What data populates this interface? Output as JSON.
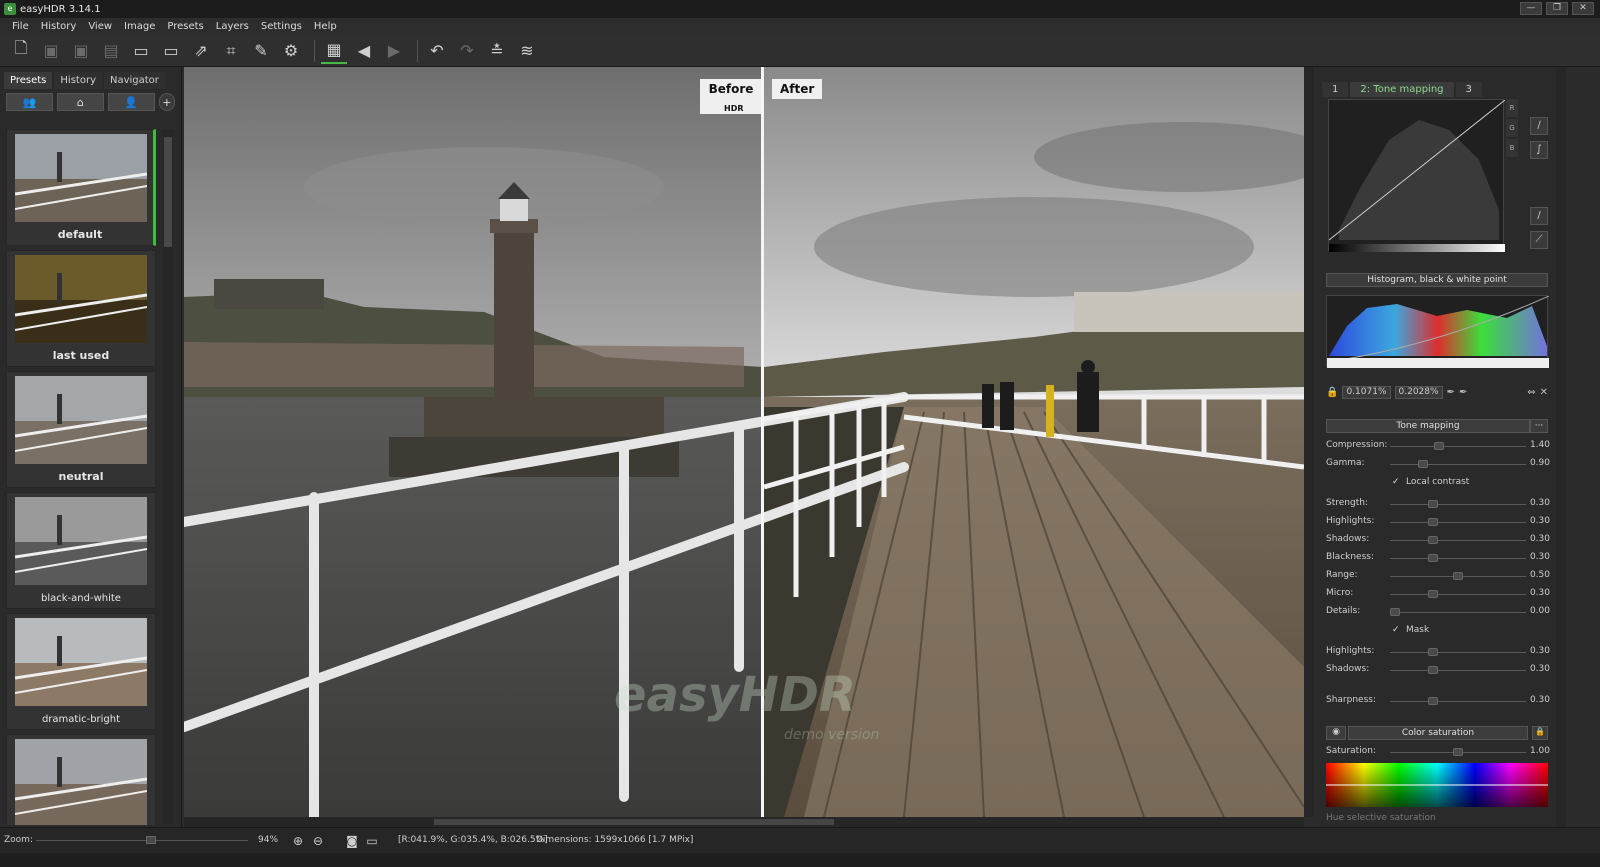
{
  "window": {
    "title": "easyHDR 3.14.1",
    "icon": "app-icon"
  },
  "window_controls": {
    "minimize": "—",
    "maximize": "❐",
    "close": "✕"
  },
  "menu": [
    "File",
    "History",
    "View",
    "Image",
    "Presets",
    "Layers",
    "Settings",
    "Help"
  ],
  "toolbar": {
    "icons": [
      "new-file-icon",
      "open-bracket-icon",
      "open-multi-icon",
      "batch-icon",
      "save-icon",
      "save-as-icon",
      "export-icon",
      "crop-icon",
      "healing-icon",
      "settings-icon",
      "preview-toggle-icon",
      "back-icon",
      "forward-icon",
      "undo-icon",
      "redo-icon",
      "auto-align-icon",
      "layers-icon"
    ]
  },
  "left_panel": {
    "tabs": [
      "Presets",
      "History",
      "Navigator"
    ],
    "active_tab": "Presets",
    "preset_filter_icons": [
      "group-users-icon",
      "home-icon",
      "user-icon",
      "add-icon"
    ],
    "presets": [
      {
        "label": "default",
        "selected": true
      },
      {
        "label": "last used"
      },
      {
        "label": "neutral"
      },
      {
        "label": "black-and-white"
      },
      {
        "label": "dramatic-bright"
      },
      {
        "label": ""
      }
    ]
  },
  "viewer": {
    "before_label": "Before",
    "before_sub": "HDR",
    "after_label": "After",
    "watermark": "easyHDR",
    "watermark_sub": "demo version"
  },
  "right_panel": {
    "tabs": [
      "1",
      "2: Tone mapping",
      "3"
    ],
    "active_tab": "2: Tone mapping",
    "rgb": [
      "R",
      "G",
      "B"
    ],
    "histogram_header": "Histogram, black & white point",
    "black_point": "0.1071%",
    "white_point": "0.2028%",
    "tone_header": "Tone mapping",
    "tone_menu": "···",
    "sliders_top": [
      {
        "label": "Compression:",
        "value": "1.40",
        "pos": 0.35
      },
      {
        "label": "Gamma:",
        "value": "0.90",
        "pos": 0.22
      }
    ],
    "local_contrast": "Local contrast",
    "sliders_local": [
      {
        "label": "Strength:",
        "value": "0.30",
        "pos": 0.3
      },
      {
        "label": "Highlights:",
        "value": "0.30",
        "pos": 0.3
      },
      {
        "label": "Shadows:",
        "value": "0.30",
        "pos": 0.3
      },
      {
        "label": "Blackness:",
        "value": "0.30",
        "pos": 0.3
      },
      {
        "label": "Range:",
        "value": "0.50",
        "pos": 0.5
      },
      {
        "label": "Micro:",
        "value": "0.30",
        "pos": 0.3
      },
      {
        "label": "Details:",
        "value": "0.00",
        "pos": 0.0
      }
    ],
    "mask": "Mask",
    "sliders_mask": [
      {
        "label": "Highlights:",
        "value": "0.30",
        "pos": 0.3
      },
      {
        "label": "Shadows:",
        "value": "0.30",
        "pos": 0.3
      }
    ],
    "sharpness": {
      "label": "Sharpness:",
      "value": "0.30",
      "pos": 0.3
    },
    "color_header": "Color saturation",
    "saturation": {
      "label": "Saturation:",
      "value": "1.00",
      "pos": 0.5
    },
    "hue_label": "Hue selective saturation"
  },
  "status": {
    "zoom_label": "Zoom:",
    "zoom_value": "94%",
    "zoom_pos": 0.55,
    "pixel_info": "[R:041.9%, G:035.4%, B:026.5%]",
    "dimensions": "Dimensions:  1599x1066 [1.7 MPix]"
  }
}
